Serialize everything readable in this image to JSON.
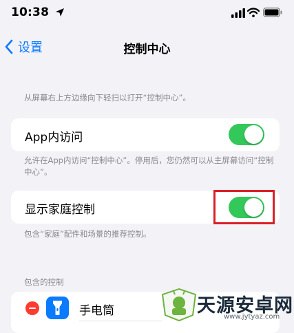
{
  "status_bar": {
    "time": "10:38"
  },
  "nav": {
    "back_label": "设置",
    "title": "控制中心"
  },
  "intro_text": "从屏幕右上方边缘向下轻扫以打开“控制中心”。",
  "in_app_access": {
    "label": "App内访问",
    "enabled": true,
    "footer": "允许在App内访问“控制中心”。停用后，您仍然可以从主屏幕访问“控制中心”。"
  },
  "home_controls": {
    "label": "显示家庭控制",
    "enabled": true,
    "footer": "包含“家庭”配件和场景的推荐控制。"
  },
  "included_controls": {
    "header": "包含的控制",
    "items": [
      {
        "label": "手电筒",
        "icon": "flashlight-icon"
      }
    ]
  },
  "watermark": {
    "title": "天源安卓网",
    "url": "www.jytyaz.com"
  },
  "colors": {
    "accent": "#0a7aff",
    "toggle_on": "#34c759",
    "highlight": "#d91f26",
    "remove": "#ff3b30",
    "background": "#f2f2f7"
  }
}
